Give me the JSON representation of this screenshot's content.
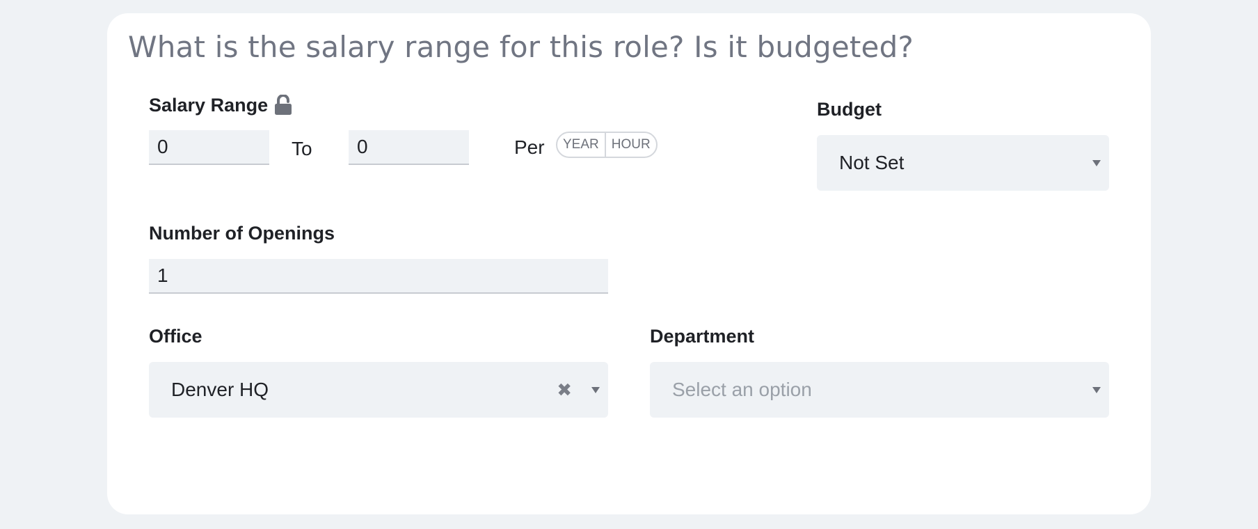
{
  "question": "What is the salary range for this role? Is it budgeted?",
  "salary": {
    "label": "Salary Range",
    "min_value": "0",
    "to_label": "To",
    "max_value": "0",
    "per_label": "Per",
    "period_options": [
      "YEAR",
      "HOUR"
    ]
  },
  "budget": {
    "label": "Budget",
    "value": "Not Set"
  },
  "openings": {
    "label": "Number of Openings",
    "value": "1"
  },
  "office": {
    "label": "Office",
    "value": "Denver HQ",
    "clear_glyph": "✖"
  },
  "department": {
    "label": "Department",
    "placeholder": "Select an option"
  },
  "icons": {
    "lock": "unlocked-padlock",
    "dropdown": "chevron-down",
    "clear": "close-x"
  },
  "colors": {
    "background": "#eff2f5",
    "card": "#ffffff",
    "question_text": "#707582",
    "label_text": "#1f2126"
  }
}
